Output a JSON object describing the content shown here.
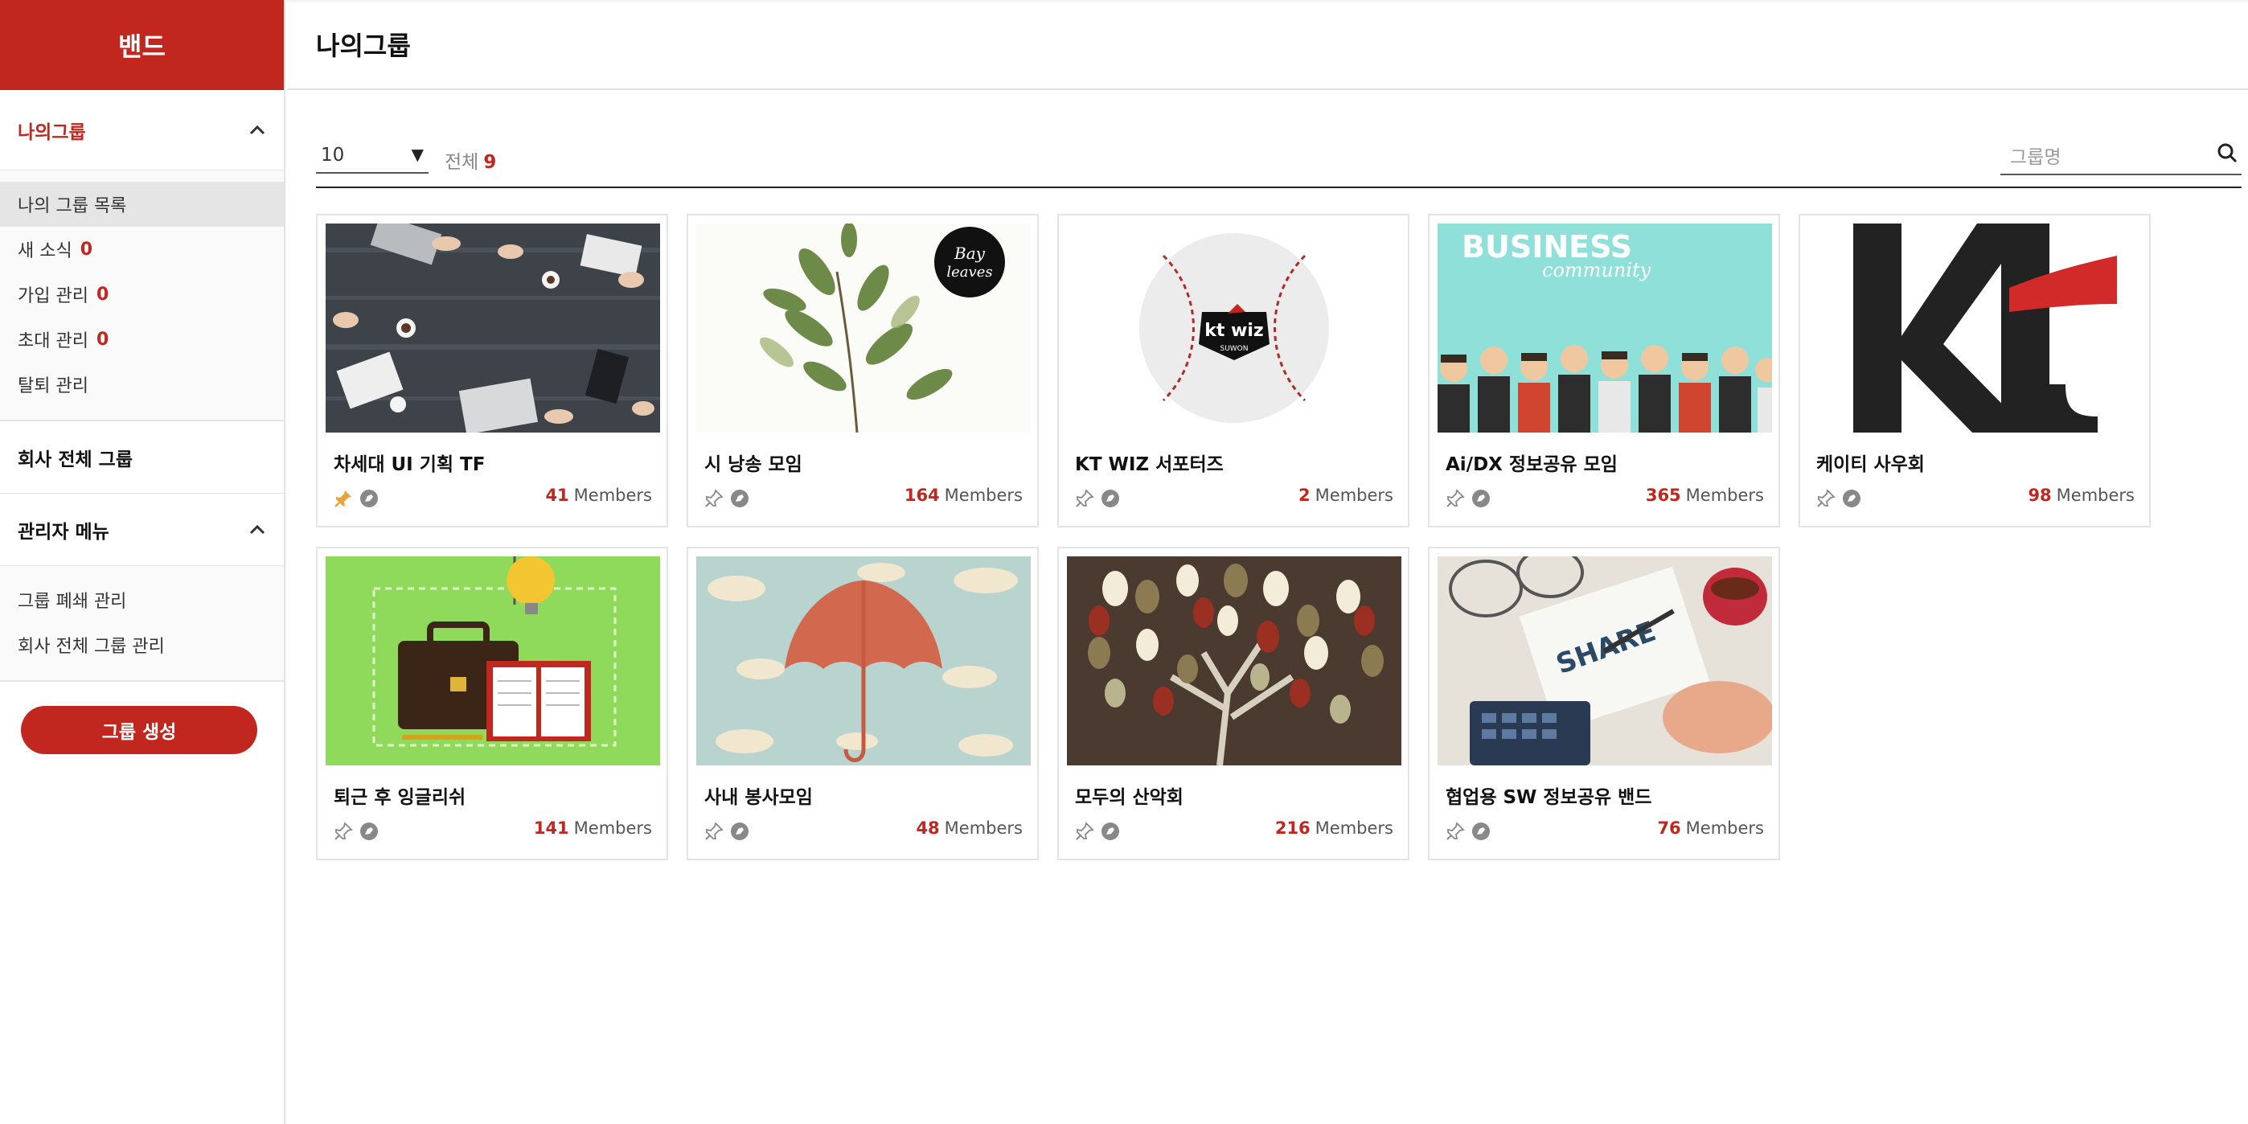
{
  "sidebar": {
    "brand": "밴드",
    "section_my": "나의그룹",
    "my_items": [
      {
        "label": "나의 그룹 목록",
        "count": ""
      },
      {
        "label": "새 소식",
        "count": "0"
      },
      {
        "label": "가입 관리",
        "count": "0"
      },
      {
        "label": "초대 관리",
        "count": "0"
      },
      {
        "label": "탈퇴 관리",
        "count": ""
      }
    ],
    "section_company": "회사 전체 그룹",
    "section_admin": "관리자 메뉴",
    "admin_items": [
      {
        "label": "그룹 폐쇄 관리"
      },
      {
        "label": "회사 전체 그룹 관리"
      }
    ],
    "create_button": "그룹 생성"
  },
  "header": {
    "title": "나의그룹"
  },
  "toolbar": {
    "page_size": "10",
    "total_label": "전체",
    "total_count": "9",
    "search_placeholder": "그룹명"
  },
  "members_suffix": "Members",
  "groups": [
    {
      "name": "차세대 UI 기획 TF",
      "members": "41",
      "pinned": true,
      "image": "meeting-table-photo"
    },
    {
      "name": "시 낭송 모임",
      "members": "164",
      "pinned": false,
      "image": "bay-leaves-illustration"
    },
    {
      "name": "KT WIZ 서포터즈",
      "members": "2",
      "pinned": false,
      "image": "kt-wiz-baseball"
    },
    {
      "name": "Ai/DX 정보공유 모임",
      "members": "365",
      "pinned": false,
      "image": "business-community-illustration"
    },
    {
      "name": "케이티 사우회",
      "members": "98",
      "pinned": false,
      "image": "kt-logo"
    },
    {
      "name": "퇴근 후 잉글리쉬",
      "members": "141",
      "pinned": false,
      "image": "briefcase-lightbulb-illustration"
    },
    {
      "name": "사내 봉사모임",
      "members": "48",
      "pinned": false,
      "image": "umbrella-illustration"
    },
    {
      "name": "모두의 산악회",
      "members": "216",
      "pinned": false,
      "image": "tree-illustration"
    },
    {
      "name": "협업용 SW 정보공유 밴드",
      "members": "76",
      "pinned": false,
      "image": "share-notebook-photo"
    }
  ],
  "thumb_text": {
    "bay_leaves": "Bay leaves",
    "kt_wiz": "kt wiz",
    "kt_wiz_sub": "SUWON",
    "business": "BUSINESS",
    "community": "community",
    "share": "SHARE"
  },
  "colors": {
    "accent": "#c1271f",
    "pin_active": "#e8a33a"
  }
}
